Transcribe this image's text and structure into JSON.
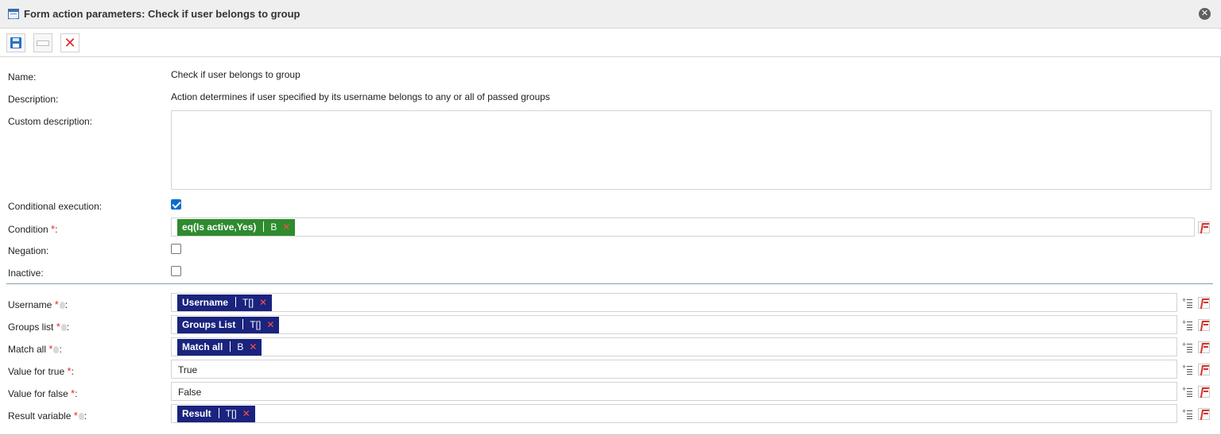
{
  "dialog": {
    "title": "Form action parameters: Check if user belongs to group"
  },
  "toolbar": {
    "save_tooltip": "Save",
    "blank_tooltip": "",
    "delete_tooltip": "Delete"
  },
  "fields": {
    "name": {
      "label": "Name:",
      "value": "Check if user belongs to group"
    },
    "description": {
      "label": "Description:",
      "value": "Action determines if user specified by its username belongs to any or all of passed groups"
    },
    "custom_description": {
      "label": "Custom description:",
      "value": ""
    },
    "conditional_execution": {
      "label": "Conditional execution:",
      "checked": true
    },
    "condition": {
      "label": "Condition",
      "required_mark": "*",
      "suffix": ":",
      "chip_text": "eq(Is active,Yes)",
      "chip_type": "B",
      "chip_remove": "✕"
    },
    "negation": {
      "label": "Negation:",
      "checked": false
    },
    "inactive": {
      "label": "Inactive:",
      "checked": false
    },
    "username": {
      "label": "Username",
      "required_mark": "*",
      "suffix": ":",
      "chip_text": "Username",
      "chip_type": "T[]",
      "chip_remove": "✕"
    },
    "groups_list": {
      "label": "Groups list",
      "required_mark": "*",
      "suffix": ":",
      "chip_text": "Groups List",
      "chip_type": "T[]",
      "chip_remove": "✕"
    },
    "match_all": {
      "label": "Match all",
      "required_mark": "*",
      "suffix": ":",
      "chip_text": "Match all",
      "chip_type": "B",
      "chip_remove": "✕"
    },
    "value_true": {
      "label": "Value for true",
      "required_mark": "*",
      "suffix": ":",
      "value": "True"
    },
    "value_false": {
      "label": "Value for false",
      "required_mark": "*",
      "suffix": ":",
      "value": "False"
    },
    "result_variable": {
      "label": "Result variable",
      "required_mark": "*",
      "suffix": ":",
      "chip_text": "Result",
      "chip_type": "T[]",
      "chip_remove": "✕"
    }
  },
  "colors": {
    "chip_green": "#2e8b2e",
    "chip_navy": "#1a237e",
    "required": "#e02b2b",
    "checkbox_checked": "#0a6ed1"
  },
  "icons": {
    "title": "table-icon",
    "close": "close-circle-icon",
    "save": "floppy-disk-icon",
    "delete": "red-x-icon",
    "map": "mapping-list-icon",
    "function": "function-fx-icon",
    "hint": "lightbulb-icon"
  }
}
